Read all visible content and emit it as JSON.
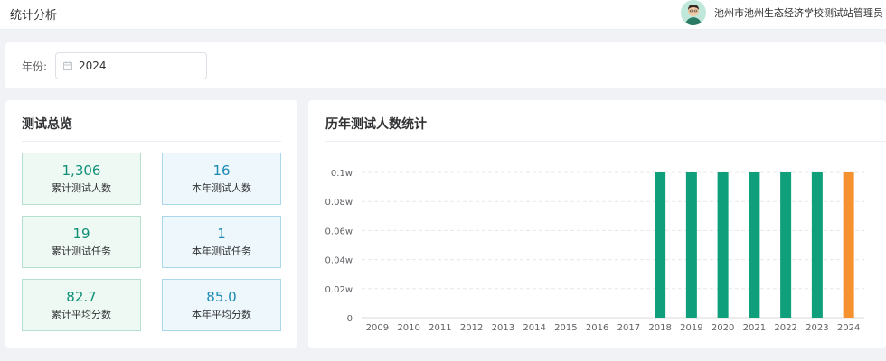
{
  "header": {
    "title": "统计分析",
    "user_name": "池州市池州生态经济学校测试站管理员"
  },
  "filter": {
    "year_label": "年份:",
    "year_value": "2024"
  },
  "overview": {
    "title": "测试总览",
    "stats": [
      {
        "value": "1,306",
        "label": "累计测试人数"
      },
      {
        "value": "16",
        "label": "本年测试人数"
      },
      {
        "value": "19",
        "label": "累计测试任务"
      },
      {
        "value": "1",
        "label": "本年测试任务"
      },
      {
        "value": "82.7",
        "label": "累计平均分数"
      },
      {
        "value": "85.0",
        "label": "本年平均分数"
      }
    ]
  },
  "chart_title": "历年测试人数统计",
  "chart_data": {
    "type": "bar",
    "title": "历年测试人数统计",
    "categories": [
      "2009",
      "2010",
      "2011",
      "2012",
      "2013",
      "2014",
      "2015",
      "2016",
      "2017",
      "2018",
      "2019",
      "2020",
      "2021",
      "2022",
      "2023",
      "2024"
    ],
    "values": [
      0,
      0,
      0,
      0,
      0,
      0,
      0,
      0,
      0,
      0.1,
      0.1,
      0.1,
      0.1,
      0.1,
      0.1,
      0.1
    ],
    "ylim": [
      0,
      0.1
    ],
    "yticks": [
      "0",
      "0.02w",
      "0.04w",
      "0.06w",
      "0.08w",
      "0.1w"
    ],
    "grid": true,
    "colors": {
      "default": "#0f9f7b",
      "highlight": "#f5922f"
    },
    "highlight_category": "2024"
  }
}
